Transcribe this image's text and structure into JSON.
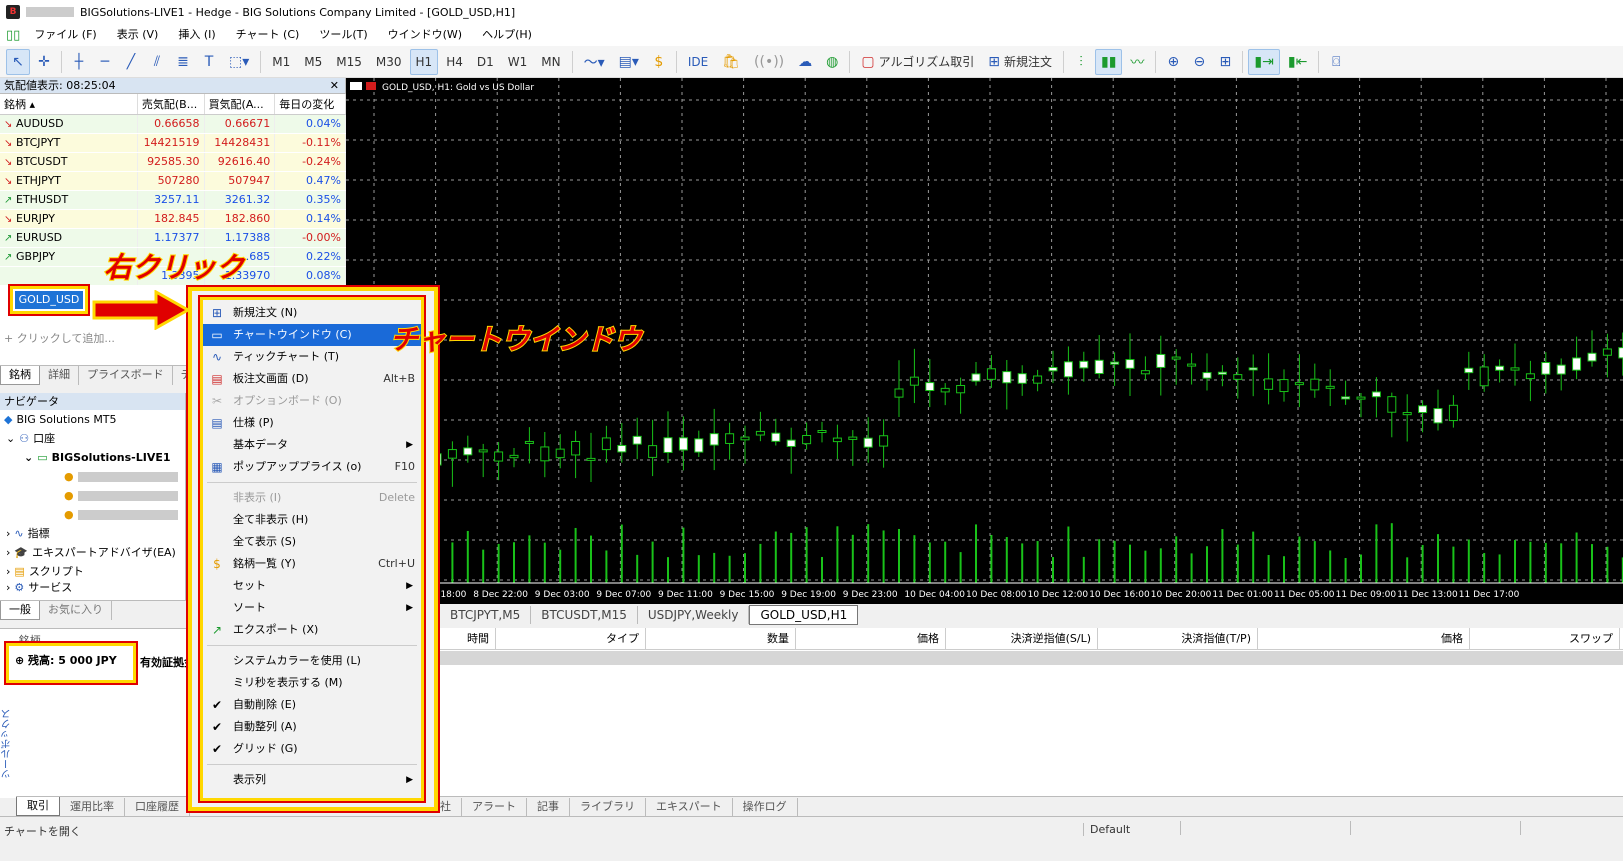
{
  "window": {
    "title": "BIGSolutions-LIVE1 - Hedge - BIG Solutions Company Limited - [GOLD_USD,H1]"
  },
  "menu": [
    "ファイル (F)",
    "表示 (V)",
    "挿入 (I)",
    "チャート (C)",
    "ツール(T)",
    "ウインドウ(W)",
    "ヘルプ(H)"
  ],
  "toolbar": {
    "timeframes": [
      "M1",
      "M5",
      "M15",
      "M30",
      "H1",
      "H4",
      "D1",
      "W1",
      "MN"
    ],
    "active_tf": "H1",
    "ide": "IDE",
    "algo": "アルゴリズム取引",
    "new_order": "新規注文"
  },
  "market_watch": {
    "header": "気配値表示: 08:25:04",
    "columns": [
      "銘柄",
      "売気配(B...",
      "買気配(A...",
      "毎日の変化"
    ],
    "rows": [
      {
        "symbol": "AUDUSD",
        "bid": "0.66658",
        "ask": "0.66671",
        "change": "0.04%",
        "dir": "dn",
        "bg": "g",
        "cbid": "red",
        "cask": "red",
        "cchg": "blue"
      },
      {
        "symbol": "BTCJPYT",
        "bid": "14421519",
        "ask": "14428431",
        "change": "-0.11%",
        "dir": "dn",
        "bg": "y",
        "cbid": "red",
        "cask": "red",
        "cchg": "red"
      },
      {
        "symbol": "BTCUSDT",
        "bid": "92585.30",
        "ask": "92616.40",
        "change": "-0.24%",
        "dir": "dn",
        "bg": "y",
        "cbid": "red",
        "cask": "red",
        "cchg": "red"
      },
      {
        "symbol": "ETHJPYT",
        "bid": "507280",
        "ask": "507947",
        "change": "0.47%",
        "dir": "dn",
        "bg": "y",
        "cbid": "red",
        "cask": "red",
        "cchg": "blue"
      },
      {
        "symbol": "ETHUSDT",
        "bid": "3257.11",
        "ask": "3261.32",
        "change": "0.35%",
        "dir": "up",
        "bg": "g",
        "cbid": "blue",
        "cask": "blue",
        "cchg": "blue"
      },
      {
        "symbol": "EURJPY",
        "bid": "182.845",
        "ask": "182.860",
        "change": "0.14%",
        "dir": "dn",
        "bg": "y",
        "cbid": "red",
        "cask": "red",
        "cchg": "blue"
      },
      {
        "symbol": "EURUSD",
        "bid": "1.17377",
        "ask": "1.17388",
        "change": "-0.00%",
        "dir": "up",
        "bg": "g",
        "cbid": "blue",
        "cask": "blue",
        "cchg": "red"
      },
      {
        "symbol": "GBPJPY",
        "bid": "",
        "ask": "...685",
        "change": "0.22%",
        "dir": "up",
        "bg": "g",
        "cbid": "blue",
        "cask": "blue",
        "cchg": "blue"
      },
      {
        "symbol": "",
        "bid": "1.3395",
        "ask": "1.33970",
        "change": "0.08%",
        "dir": "",
        "bg": "g",
        "cbid": "blue",
        "cask": "blue",
        "cchg": "blue"
      }
    ],
    "selected": "GOLD_USD",
    "add": "+ クリックして追加...",
    "tabs": [
      "銘柄",
      "詳細",
      "プライスボード",
      "デ"
    ]
  },
  "navigator": {
    "header": "ナビゲータ",
    "broker": "BIG Solutions MT5",
    "account": "口座",
    "login": "BIGSolutions-LIVE1",
    "items": [
      "指標",
      "エキスパートアドバイザ(EA)",
      "スクリプト",
      "サービス"
    ],
    "tabs": [
      "一般",
      "お気に入り"
    ]
  },
  "chart": {
    "label": "GOLD_USD, H1:  Gold vs US Dollar",
    "xlabels": [
      ":00",
      "8 Dec 18:00",
      "8 Dec 22:00",
      "9 Dec 03:00",
      "9 Dec 07:00",
      "9 Dec 11:00",
      "9 Dec 15:00",
      "9 Dec 19:00",
      "9 Dec 23:00",
      "10 Dec 04:00",
      "10 Dec 08:00",
      "10 Dec 12:00",
      "10 Dec 16:00",
      "10 Dec 20:00",
      "11 Dec 01:00",
      "11 Dec 05:00",
      "11 Dec 09:00",
      "11 Dec 13:00",
      "11 Dec 17:00"
    ],
    "tabs": [
      "BTCJPYT,M5",
      "BTCUSDT,M15",
      "USDJPY,Weekly",
      "GOLD_USD,H1"
    ],
    "active_tab": "GOLD_USD,H1"
  },
  "toolbox": {
    "columns": [
      "時間",
      "タイプ",
      "数量",
      "価格",
      "決済逆指値(S/L)",
      "決済指値(T/P)",
      "価格",
      "スワップ"
    ],
    "balance": "⊕ 残高: 5 000 JPY",
    "margin": "有効証拠金:",
    "vertical": "ツールボックス",
    "left_tab": "銘柄",
    "tabs": [
      "取引",
      "運用比率",
      "口座履歴",
      "",
      "",
      "",
      "",
      "",
      "社",
      "アラート",
      "記事",
      "ライブラリ",
      "エキスパート",
      "操作ログ"
    ]
  },
  "status": {
    "left": "チャートを開く",
    "right": "Default"
  },
  "context_menu": [
    {
      "label": "新規注文 (N)",
      "icon": "plus-doc-icon",
      "sc": ""
    },
    {
      "label": "チャートウインドウ (C)",
      "icon": "chart-window-icon",
      "sc": "",
      "hl": true
    },
    {
      "label": "ティックチャート (T)",
      "icon": "tick-chart-icon",
      "sc": ""
    },
    {
      "label": "板注文画面 (D)",
      "icon": "dom-icon",
      "sc": "Alt+B"
    },
    {
      "label": "オプションボード (O)",
      "icon": "option-icon",
      "sc": "",
      "dis": true
    },
    {
      "label": "仕様 (P)",
      "icon": "spec-icon",
      "sc": ""
    },
    {
      "label": "基本データ",
      "icon": "",
      "sc": "",
      "sub": true
    },
    {
      "label": "ポップアッププライス (o)",
      "icon": "popup-icon",
      "sc": "F10"
    },
    {
      "sep": true
    },
    {
      "label": "非表示 (I)",
      "icon": "",
      "sc": "Delete",
      "dis": true
    },
    {
      "label": "全て非表示 (H)",
      "icon": "",
      "sc": ""
    },
    {
      "label": "全て表示 (S)",
      "icon": "",
      "sc": ""
    },
    {
      "label": "銘柄一覧 (Y)",
      "icon": "dollar-icon",
      "sc": "Ctrl+U"
    },
    {
      "label": "セット",
      "icon": "",
      "sc": "",
      "sub": true
    },
    {
      "label": "ソート",
      "icon": "",
      "sc": "",
      "sub": true
    },
    {
      "label": "エクスポート (X)",
      "icon": "export-icon",
      "sc": ""
    },
    {
      "sep": true
    },
    {
      "label": "システムカラーを使用 (L)",
      "icon": "",
      "sc": ""
    },
    {
      "label": "ミリ秒を表示する (M)",
      "icon": "",
      "sc": ""
    },
    {
      "label": "自動削除 (E)",
      "icon": "check-icon",
      "sc": ""
    },
    {
      "label": "自動整列 (A)",
      "icon": "check-icon",
      "sc": ""
    },
    {
      "label": "グリッド (G)",
      "icon": "check-icon",
      "sc": ""
    },
    {
      "sep": true
    },
    {
      "label": "表示列",
      "icon": "",
      "sc": "",
      "sub": true
    }
  ],
  "annotations": {
    "right_click": "右クリック",
    "chart_window": "チャートウインドウ"
  }
}
